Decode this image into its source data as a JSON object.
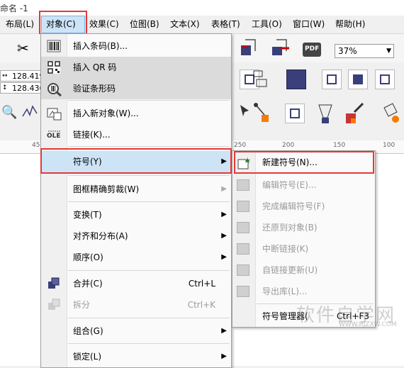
{
  "title": "命名 -1",
  "menubar": [
    {
      "label": "布局(L)"
    },
    {
      "label": "对象(C)"
    },
    {
      "label": "效果(C)"
    },
    {
      "label": "位图(B)"
    },
    {
      "label": "文本(X)"
    },
    {
      "label": "表格(T)"
    },
    {
      "label": "工具(O)"
    },
    {
      "label": "窗口(W)"
    },
    {
      "label": "帮助(H)"
    }
  ],
  "toolbar": {
    "zoom": "37%",
    "x_value": "128.419",
    "y_value": "128.436",
    "pdf_label": "PDF",
    "ole_label": "OLE"
  },
  "ruler": [
    "45",
    "250",
    "200",
    "150",
    "100"
  ],
  "object_menu": {
    "items": [
      {
        "label": "插入条码(B)...",
        "icon": "barcode-icon"
      },
      {
        "label": "插入 QR 码",
        "icon": "qr-code-icon"
      },
      {
        "label": "验证条形码",
        "icon": "magnifier-barcode-icon"
      },
      {
        "label": "插入新对象(W)...",
        "icon": "insert-object-icon"
      },
      {
        "label": "链接(K)...",
        "icon": "ole-icon"
      },
      {
        "label": "符号(Y)",
        "icon": ""
      },
      {
        "label": "图框精确剪裁(W)",
        "icon": ""
      },
      {
        "label": "变换(T)",
        "icon": ""
      },
      {
        "label": "对齐和分布(A)",
        "icon": ""
      },
      {
        "label": "顺序(O)",
        "icon": ""
      },
      {
        "label": "合并(C)",
        "shortcut": "Ctrl+L",
        "icon": "combine-icon"
      },
      {
        "label": "拆分",
        "shortcut": "Ctrl+K",
        "icon": "break-apart-icon"
      },
      {
        "label": "组合(G)",
        "icon": ""
      },
      {
        "label": "锁定(L)",
        "icon": ""
      }
    ]
  },
  "symbol_menu": {
    "items": [
      {
        "label": "新建符号(N)...",
        "enabled": true
      },
      {
        "label": "编辑符号(E)...",
        "enabled": false
      },
      {
        "label": "完成编辑符号(F)",
        "enabled": false
      },
      {
        "label": "还原到对象(B)",
        "enabled": false
      },
      {
        "label": "中断链接(K)",
        "enabled": false
      },
      {
        "label": "自链接更新(U)",
        "enabled": false
      },
      {
        "label": "导出库(L)...",
        "enabled": false
      },
      {
        "label": "符号管理器(",
        "shortcut": "Ctrl+F3",
        "enabled": true
      }
    ]
  },
  "watermark": {
    "text": "软件自学网",
    "url": "WWW.RJZXW.COM"
  },
  "colors": {
    "highlight": "#cde4f7",
    "red_outline": "#e53935",
    "icon_blue": "#3a3f7a"
  }
}
